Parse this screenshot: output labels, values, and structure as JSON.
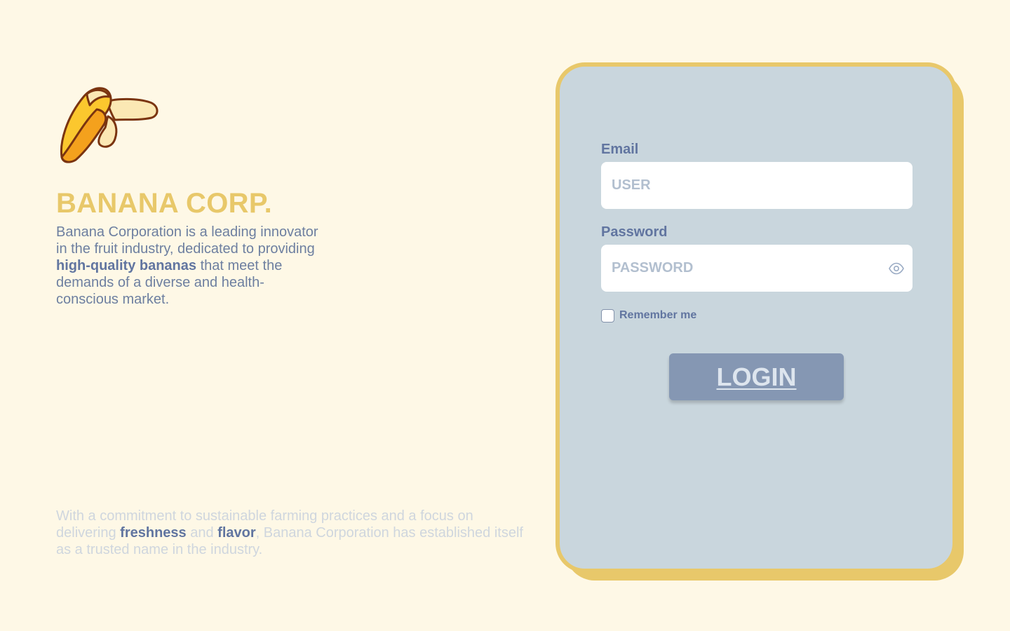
{
  "brand": {
    "logo_icon": "banana-icon",
    "title": "BANANA CORP.",
    "description": {
      "part1": "Banana Corporation is a leading innovator in the fruit industry, dedicated to providing ",
      "highlight": "high-quality bananas",
      "part2": " that meet the demands of a diverse and health-conscious market."
    }
  },
  "footer": {
    "part1": "With a commitment to sustainable farming practices and a focus on delivering ",
    "highlight1": "freshness",
    "and": " and ",
    "highlight2": "flavor",
    "part2": ", Banana Corporation has established itself as a trusted name in the industry."
  },
  "login": {
    "email_label": "Email",
    "email_placeholder": "USER",
    "email_value": "",
    "password_label": "Password",
    "password_placeholder": "PASSWORD",
    "password_value": "",
    "password_toggle_icon": "eye-icon",
    "remember_label": "Remember me",
    "remember_checked": false,
    "button_label": "LOGIN"
  },
  "colors": {
    "background": "#fef8e6",
    "accent_yellow": "#e8c86a",
    "card": "#c9d6dd",
    "text_blue": "#6175a0",
    "button": "#8597b3"
  }
}
